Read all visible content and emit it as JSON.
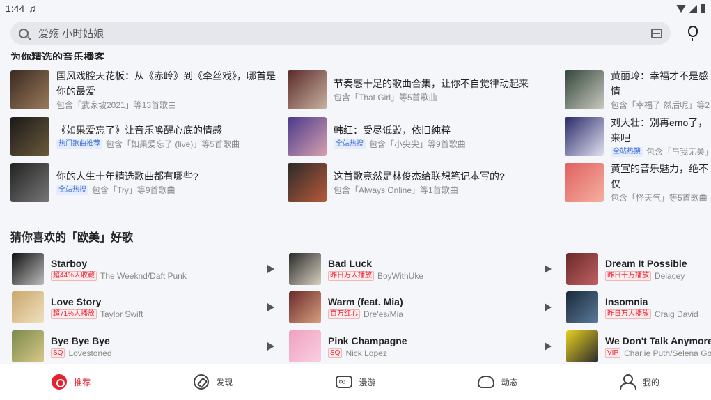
{
  "status_bar": {
    "time": "1:44",
    "music_glyph": "♫"
  },
  "search": {
    "text": "爱殇 小时姑娘"
  },
  "section1": {
    "title": "为你精选的音乐播客",
    "items": [
      {
        "title": "国风戏腔天花板：从《赤岭》到《牵丝戏》，哪首是你的最爱",
        "sub": "包含「武家坡2021」等13首歌曲",
        "tag": "",
        "cover": "#3a2a22",
        "cover2": "#9b7b5b"
      },
      {
        "title": "《如果爱忘了》让音乐唤醒心底的情感",
        "sub": "包含「如果爱忘了 (live)」等5首歌曲",
        "tag": "热门歌曲推荐",
        "cover": "#1a1a1a",
        "cover2": "#6b5a3a"
      },
      {
        "title": "你的人生十年精选歌曲都有哪些?",
        "sub": "包含「Try」等9首歌曲",
        "tag": "全站热搜",
        "cover": "#222",
        "cover2": "#777"
      },
      {
        "title": "节奏感十足的歌曲合集，让你不自觉律动起来",
        "sub": "包含「That Girl」等5首歌曲",
        "tag": "",
        "cover": "#5a2a2a",
        "cover2": "#c9b2a0"
      },
      {
        "title": "韩红：受尽诋毁，依旧纯粹",
        "sub": "包含「小尖尖」等9首歌曲",
        "tag": "全站热搜",
        "cover": "#4a3a8a",
        "cover2": "#d6a0b0"
      },
      {
        "title": "这首歌竟然是林俊杰给联想笔记本写的?",
        "sub": "包含「Always Online」等1首歌曲",
        "tag": "",
        "cover": "#2a2a2a",
        "cover2": "#b85a3a"
      },
      {
        "title": "黄丽玲：幸福才不是感情",
        "sub": "包含「幸福了 然后呢」等2",
        "tag": "",
        "cover": "#33463a",
        "cover2": "#c9c9c0"
      },
      {
        "title": "刘大壮：别再emo了，来吧",
        "sub": "包含「与我无关」等",
        "tag": "全站热搜",
        "cover": "#2a2a6a",
        "cover2": "#e0e0f0"
      },
      {
        "title": "黄宣的音乐魅力，绝不仅",
        "sub": "包含「怪天气」等5首歌曲",
        "tag": "",
        "cover": "#e06060",
        "cover2": "#f5b0a0"
      }
    ]
  },
  "section2": {
    "title": "猜你喜欢的「欧美」好歌",
    "songs": [
      {
        "name": "Starboy",
        "tag": "超44%人收藏",
        "artist": "The Weeknd/Daft Punk",
        "cover": "#111",
        "cover2": "#bbb"
      },
      {
        "name": "Love Story",
        "tag": "超71%人播放",
        "artist": "Taylor Swift",
        "cover": "#c9a86a",
        "cover2": "#f0e0c0"
      },
      {
        "name": "Bye Bye Bye",
        "tag": "SQ",
        "artist": "Lovestoned",
        "cover": "#7a8a4a",
        "cover2": "#d8c88a"
      },
      {
        "name": "Bad Luck",
        "tag": "昨日万人播放",
        "artist": "BoyWithUke",
        "cover": "#2a2a2a",
        "cover2": "#d8d0c0"
      },
      {
        "name": "Warm (feat. Mia)",
        "tag": "百万红心",
        "artist": "Dre'es/Mia",
        "cover": "#6a2a2a",
        "cover2": "#d8a080"
      },
      {
        "name": "Pink Champagne",
        "tag": "SQ",
        "artist": "Nick Lopez",
        "cover": "#f0a0c0",
        "cover2": "#f8d0e0"
      },
      {
        "name": "Dream It Possible",
        "tag": "昨日十万播放",
        "artist": "Delacey",
        "cover": "#6a2a2a",
        "cover2": "#c06060"
      },
      {
        "name": "Insomnia",
        "tag": "昨日万人播放",
        "artist": "Craig David",
        "cover": "#1a2a3a",
        "cover2": "#5a7a9a"
      },
      {
        "name": "We Don't Talk Anymore",
        "tag": "VIP",
        "artist": "Charlie Puth/Selena Gomez",
        "cover": "#e8d020",
        "cover2": "#2a2a2a"
      }
    ]
  },
  "nav": [
    {
      "label": "推荐",
      "icon": "netease-icon"
    },
    {
      "label": "发现",
      "icon": "compass-icon"
    },
    {
      "label": "漫游",
      "icon": "vr-icon"
    },
    {
      "label": "动态",
      "icon": "cloud-icon"
    },
    {
      "label": "我的",
      "icon": "user-icon"
    }
  ],
  "accent": "#e5222f"
}
